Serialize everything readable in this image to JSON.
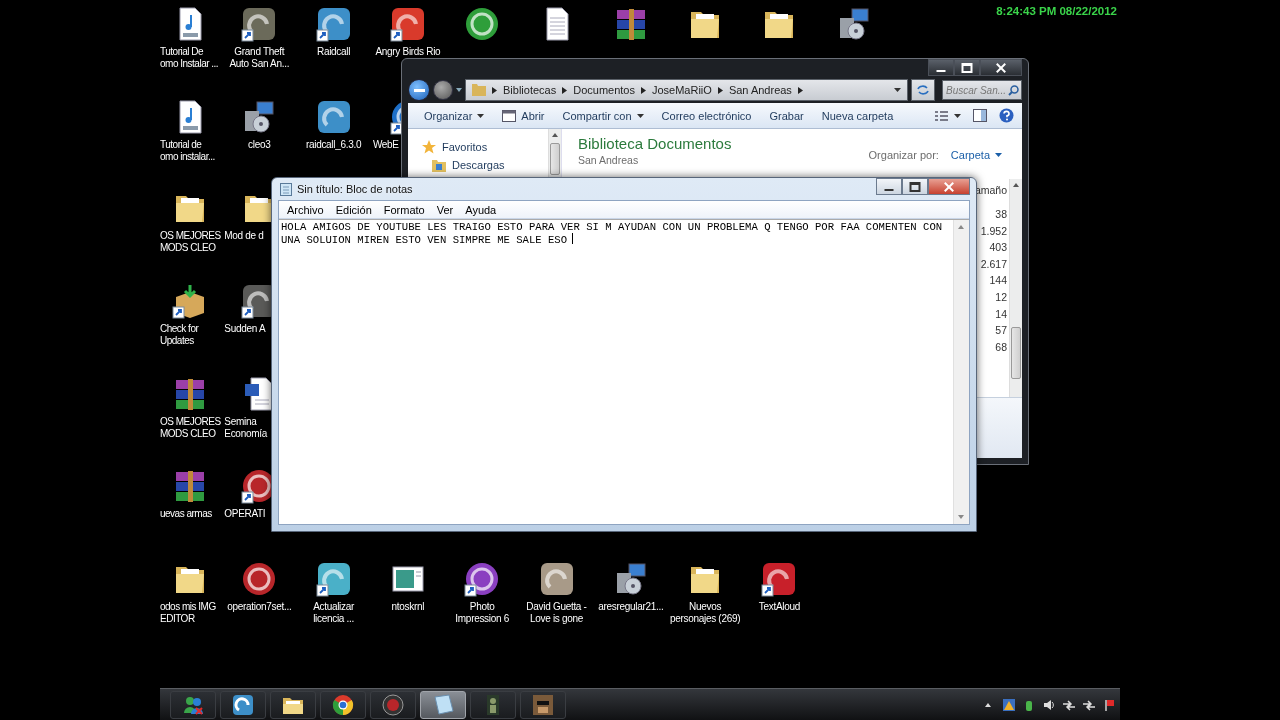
{
  "clock": "8:24:43 PM 08/22/2012",
  "desktop_icons": [
    {
      "kind": "audio",
      "shortcut": false,
      "label_lines": [
        "Tutorial De",
        "omo Instalar ..."
      ]
    },
    {
      "kind": "tile",
      "color": "#6b6a5a",
      "shortcut": true,
      "label_lines": [
        "Grand Theft",
        "Auto San An..."
      ]
    },
    {
      "kind": "tile",
      "color": "#3d8fc8",
      "shortcut": true,
      "label_lines": [
        "Raidcall"
      ]
    },
    {
      "kind": "tile",
      "color": "#d93a2b",
      "shortcut": true,
      "label_lines": [
        "Angry Birds Rio"
      ]
    },
    {
      "kind": "round",
      "color": "#2e9e3a",
      "shortcut": false
    },
    {
      "kind": "document",
      "shortcut": false
    },
    {
      "kind": "archive",
      "shortcut": false
    },
    {
      "kind": "folder",
      "shortcut": false
    },
    {
      "kind": "folder",
      "shortcut": false
    },
    {
      "kind": "installer",
      "shortcut": false
    },
    {
      "kind": "audio",
      "shortcut": false,
      "label_lines": [
        "Tutorial de",
        "omo instalar..."
      ]
    },
    {
      "kind": "installer",
      "shortcut": false,
      "label_lines": [
        "cleo3"
      ]
    },
    {
      "kind": "tile",
      "color": "#3d8fc8",
      "shortcut": false,
      "label_lines": [
        "raidcall_6.3.0"
      ]
    },
    {
      "kind": "round",
      "color": "#1e6fc8",
      "shortcut": true,
      "label_lines": [
        "WebE"
      ]
    },
    {
      "kind": "folder",
      "shortcut": false,
      "label_lines": [
        "OS MEJORES",
        "MODS CLEO"
      ]
    },
    {
      "kind": "folder",
      "shortcut": false,
      "label_lines": [
        "Mod de d"
      ]
    },
    {
      "kind": "package",
      "shortcut": true,
      "label_lines": [
        "Check for",
        "Updates"
      ]
    },
    {
      "kind": "tile",
      "color": "#5a5a58",
      "shortcut": true,
      "label_lines": [
        "Sudden A"
      ]
    },
    {
      "kind": "archive",
      "shortcut": false,
      "label_lines": [
        "OS MEJORES",
        "MODS CLEO"
      ]
    },
    {
      "kind": "word",
      "shortcut": false,
      "label_lines": [
        "Semina",
        "Economía"
      ]
    },
    {
      "kind": "archive",
      "shortcut": false,
      "label_lines": [
        "uevas armas"
      ]
    },
    {
      "kind": "round",
      "color": "#b8262a",
      "shortcut": true,
      "label_lines": [
        "OPERATI"
      ]
    },
    {
      "kind": "folder",
      "shortcut": false,
      "label_lines": [
        "odos mis IMG",
        "EDITOR"
      ]
    },
    {
      "kind": "round",
      "color": "#b8262a",
      "shortcut": false,
      "label_lines": [
        "operation7set..."
      ]
    },
    {
      "kind": "tile",
      "color": "#4ab0c8",
      "shortcut": true,
      "label_lines": [
        "Actualizar",
        "licencia ..."
      ]
    },
    {
      "kind": "image",
      "shortcut": false,
      "label_lines": [
        "ntoskrnl"
      ]
    },
    {
      "kind": "round",
      "color": "#8a3fc0",
      "shortcut": true,
      "label_lines": [
        "Photo",
        "Impression 6"
      ]
    },
    {
      "kind": "tile",
      "color": "#a89a88",
      "shortcut": false,
      "label_lines": [
        "David Guetta -",
        "Love is gone"
      ]
    },
    {
      "kind": "installer",
      "shortcut": false,
      "label_lines": [
        "aresregular21..."
      ]
    },
    {
      "kind": "folder",
      "shortcut": false,
      "label_lines": [
        "Nuevos",
        "personajes (269)"
      ]
    },
    {
      "kind": "tile",
      "color": "#c8202a",
      "shortcut": true,
      "label_lines": [
        "TextAloud"
      ]
    }
  ],
  "explorer": {
    "breadcrumbs": [
      "Bibliotecas",
      "Documentos",
      "JoseMaRiiO",
      "San Andreas"
    ],
    "search": {
      "placeholder": "Buscar San..."
    },
    "toolbar": [
      {
        "label": "Organizar",
        "kind": "dropdown"
      },
      {
        "label": "Abrir",
        "kind": "open"
      },
      {
        "label": "Compartir con",
        "kind": "dropdown"
      },
      {
        "label": "Correo electrónico",
        "kind": "plain"
      },
      {
        "label": "Grabar",
        "kind": "plain"
      },
      {
        "label": "Nueva carpeta",
        "kind": "plain"
      }
    ],
    "nav_items": [
      {
        "label": "Favoritos",
        "kind": "favorites"
      },
      {
        "label": "Descargas",
        "kind": "folder"
      }
    ],
    "library_title": "Biblioteca Documentos",
    "library_subtitle": "San Andreas",
    "arrange_label": "Organizar por:",
    "arrange_value": "Carpeta",
    "size_column": {
      "header": "amaño",
      "values": [
        "38",
        "1.952",
        "403",
        "2.617",
        "144",
        "12",
        "14",
        "57",
        "68"
      ]
    }
  },
  "notepad": {
    "title": "Sin título: Bloc de notas",
    "menu": [
      "Archivo",
      "Edición",
      "Formato",
      "Ver",
      "Ayuda"
    ],
    "text": "HOLA AMIGOS DE YOUTUBE LES TRAIGO ESTO PARA VER SI M AYUDAN CON UN PROBLEMA Q TENGO POR FAA COMENTEN CON UNA SOLUION MIREN ESTO VEN SIMPRE ME SALE ESO"
  },
  "taskbar": {
    "items": [
      {
        "kind": "messenger",
        "active": false
      },
      {
        "kind": "raidcall",
        "active": false
      },
      {
        "kind": "folders",
        "active": false
      },
      {
        "kind": "chrome",
        "active": false
      },
      {
        "kind": "operation7",
        "active": false
      },
      {
        "kind": "notepad",
        "active": true
      },
      {
        "kind": "game-console",
        "active": false
      },
      {
        "kind": "game-character",
        "active": false
      }
    ],
    "tray": [
      {
        "kind": "show-hidden"
      },
      {
        "kind": "warning"
      },
      {
        "kind": "device"
      },
      {
        "kind": "volume"
      },
      {
        "kind": "network"
      },
      {
        "kind": "network"
      },
      {
        "kind": "flag"
      }
    ]
  }
}
